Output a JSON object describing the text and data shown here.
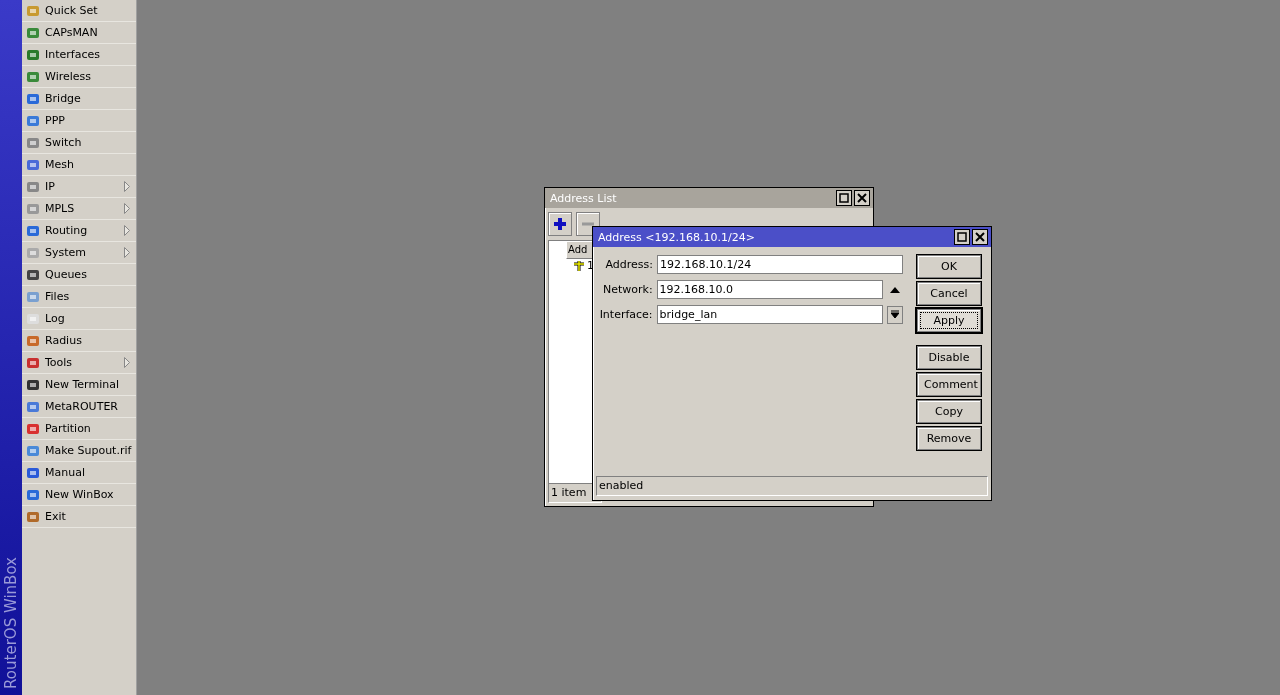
{
  "sidebar": {
    "brand": "RouterOS WinBox",
    "items": [
      {
        "label": "Quick Set",
        "submenu": false
      },
      {
        "label": "CAPsMAN",
        "submenu": false
      },
      {
        "label": "Interfaces",
        "submenu": false
      },
      {
        "label": "Wireless",
        "submenu": false
      },
      {
        "label": "Bridge",
        "submenu": false
      },
      {
        "label": "PPP",
        "submenu": false
      },
      {
        "label": "Switch",
        "submenu": false
      },
      {
        "label": "Mesh",
        "submenu": false
      },
      {
        "label": "IP",
        "submenu": true
      },
      {
        "label": "MPLS",
        "submenu": true
      },
      {
        "label": "Routing",
        "submenu": true
      },
      {
        "label": "System",
        "submenu": true
      },
      {
        "label": "Queues",
        "submenu": false
      },
      {
        "label": "Files",
        "submenu": false
      },
      {
        "label": "Log",
        "submenu": false
      },
      {
        "label": "Radius",
        "submenu": false
      },
      {
        "label": "Tools",
        "submenu": true
      },
      {
        "label": "New Terminal",
        "submenu": false
      },
      {
        "label": "MetaROUTER",
        "submenu": false
      },
      {
        "label": "Partition",
        "submenu": false
      },
      {
        "label": "Make Supout.rif",
        "submenu": false
      },
      {
        "label": "Manual",
        "submenu": false
      },
      {
        "label": "New WinBox",
        "submenu": false
      },
      {
        "label": "Exit",
        "submenu": false
      }
    ]
  },
  "address_list": {
    "title": "Address List",
    "column_1": "Add",
    "row_1": "1",
    "status": "1 item"
  },
  "dialog": {
    "title": "Address <192.168.10.1/24>",
    "fields": [
      {
        "label": "Address:",
        "value": "192.168.10.1/24",
        "kind": "plain"
      },
      {
        "label": "Network:",
        "value": "192.168.10.0",
        "kind": "toggle"
      },
      {
        "label": "Interface:",
        "value": "bridge_lan",
        "kind": "dropdown"
      }
    ],
    "buttons": [
      {
        "label": "OK",
        "focused": false
      },
      {
        "label": "Cancel",
        "focused": false
      },
      {
        "label": "Apply",
        "focused": true
      },
      {
        "label": "Disable",
        "focused": false
      },
      {
        "label": "Comment",
        "focused": false
      },
      {
        "label": "Copy",
        "focused": false
      },
      {
        "label": "Remove",
        "focused": false
      }
    ],
    "status": "enabled"
  }
}
